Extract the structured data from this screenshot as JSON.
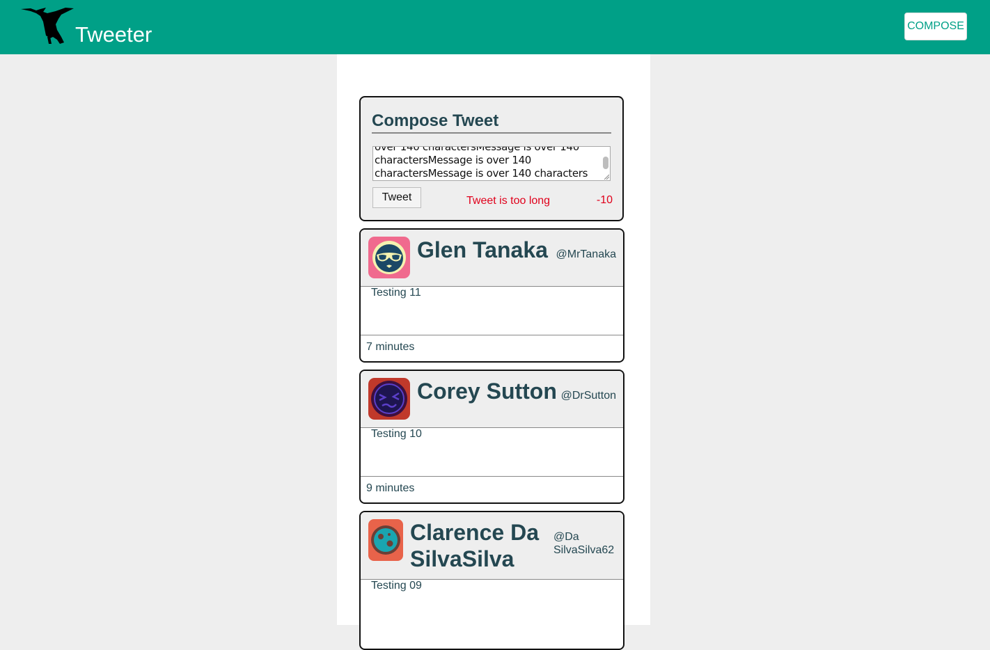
{
  "app": {
    "name": "Tweeter",
    "compose_button": "COMPOSE"
  },
  "colors": {
    "brand": "#00a087",
    "text": "#244751",
    "error": "#e0001b",
    "page_bg": "#eeeeee"
  },
  "compose": {
    "title": "Compose Tweet",
    "textarea_value": "over 140 charactersMessage is over 140 charactersMessage is over 140 charactersMessage is over 140 characters",
    "tweet_button": "Tweet",
    "error": "Tweet is too long",
    "counter": "-10"
  },
  "tweets": [
    {
      "name": "Glen Tanaka",
      "handle": "@MrTanaka",
      "content": "Testing 11",
      "time": "7 minutes",
      "avatar_icon": "sunglasses-face-icon"
    },
    {
      "name": "Corey Sutton",
      "handle": "@DrSutton",
      "content": "Testing 10",
      "time": "9 minutes",
      "avatar_icon": "squinting-face-icon"
    },
    {
      "name": "Clarence Da SilvaSilva",
      "handle": "@Da SilvaSilva62",
      "content": "Testing 09",
      "time": "",
      "avatar_icon": "globe-face-icon"
    }
  ]
}
